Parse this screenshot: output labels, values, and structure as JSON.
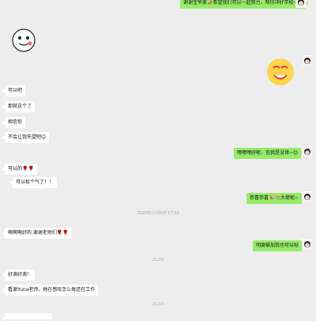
{
  "messages": {
    "m1": "谢谢宝爷美🤣希望我们可以一起努力，帮你冲好学校~😊",
    "m2": "可以吧",
    "m3": "那就这个了",
    "m4": "相信你",
    "m5": "不会让我失望吧😊",
    "m6": "嘿嘿嘿好呢，信我是没错~😊",
    "m7": "可以的🌹🌹",
    "m8": "可以松个气了！！",
    "m9": "恭喜恭喜🎉🎊大佬呢~",
    "m10": "啊啊啊好的 谢谢老师们🌹🌹",
    "m11": "明度输加我也可以哒",
    "m12": "好滴好滴！",
    "m13": "看谢Yuna老师，他在感叹怎么每还在工作"
  },
  "timestamps": {
    "t1": "2020年11月9日 17:09",
    "t2": "21:03",
    "t3": "21:03"
  },
  "stickers": {
    "left_sticker": "cartoon-face-sticker",
    "right_sticker": "laughing-face-sticker"
  },
  "colors": {
    "background": "#ededed",
    "left_bubble": "#ffffff",
    "right_bubble": "#95ec69"
  }
}
